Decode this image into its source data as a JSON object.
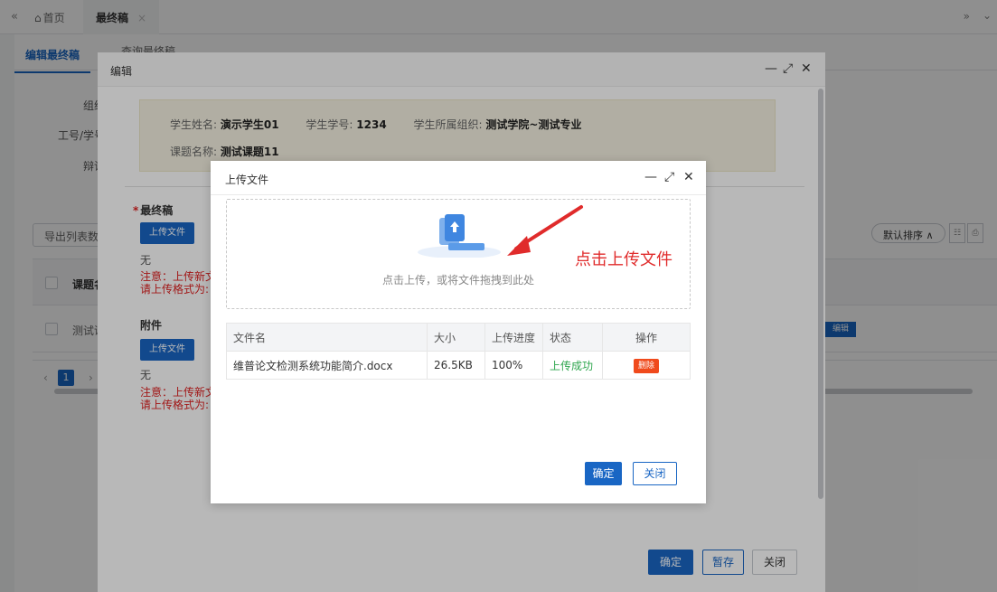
{
  "topbar": {
    "home_label": "首页",
    "active_tab_label": "最终稿"
  },
  "page": {
    "tab_active": "编辑最终稿",
    "tab_second": "查询最终稿",
    "form_labels": [
      "组织",
      "工号/学号",
      "辩论"
    ],
    "export_label": "导出列表数",
    "grid_header_first": "课题名",
    "grid_row_first": "测试课",
    "pager_current": "1",
    "sort_label": "默认排序 ∧",
    "grid_edit_label": "编辑"
  },
  "edit_dialog": {
    "title": "编辑",
    "info": {
      "student_name_label": "学生姓名:",
      "student_name": "演示学生01",
      "student_id_label": "学生学号:",
      "student_id": "1234",
      "org_label": "学生所属组织:",
      "org": "测试学院~测试专业",
      "topic_label": "课题名称:",
      "topic": "测试课题11"
    },
    "final_label": "最终稿",
    "upload_btn": "上传文件",
    "final_value": "无",
    "warn_line1": "注意：上传新文",
    "warn_line2": "请上传格式为:",
    "attach_label": "附件",
    "attach_upload_btn": "上传文件",
    "attach_value": "无",
    "attach_warn_line1": "注意：上传新文",
    "attach_warn_line2": "请上传格式为:",
    "confirm": "确定",
    "save_draft": "暂存",
    "close": "关闭"
  },
  "upload_dialog": {
    "title": "上传文件",
    "drop_hint": "点击上传，或将文件拖拽到此处",
    "callout": "点击上传文件",
    "columns": [
      "文件名",
      "大小",
      "上传进度",
      "状态",
      "操作"
    ],
    "rows": [
      {
        "name": "维普论文检测系统功能简介.docx",
        "size": "26.5KB",
        "progress": "100%",
        "status": "上传成功",
        "action": "删除"
      }
    ],
    "confirm": "确定",
    "close": "关闭"
  }
}
